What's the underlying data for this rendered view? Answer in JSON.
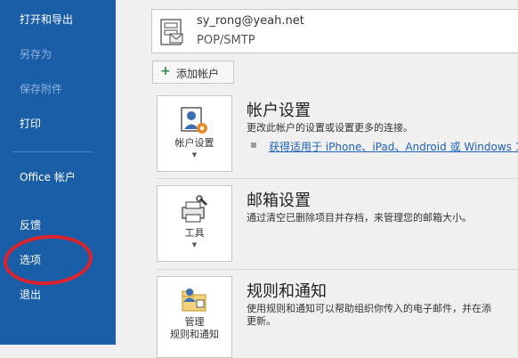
{
  "nav": {
    "items": [
      {
        "label": "打开和导出",
        "enabled": true
      },
      {
        "label": "另存为",
        "enabled": false
      },
      {
        "label": "保存附件",
        "enabled": false
      },
      {
        "label": "打印",
        "enabled": true
      },
      {
        "label": "Office 帐户",
        "enabled": true
      },
      {
        "label": "反馈",
        "enabled": true
      },
      {
        "label": "选项",
        "enabled": true
      },
      {
        "label": "退出",
        "enabled": true
      }
    ]
  },
  "account": {
    "email": "sy_rong@yeah.net",
    "type": "POP/SMTP",
    "icon": "mail-server-icon"
  },
  "add_account_label": "添加帐户",
  "sections": [
    {
      "tile_label": "帐户设置",
      "icon": "account-settings-icon",
      "title": "帐户设置",
      "description": "更改此帐户的设置或设置更多的连接。",
      "link": "获得适用于 iPhone、iPad、Android 或 Windows 1"
    },
    {
      "tile_label": "工具",
      "icon": "tools-icon",
      "title": "邮箱设置",
      "description": "通过清空已删除项目并存档，来管理您的邮箱大小。"
    },
    {
      "tile_label_line1": "管理",
      "tile_label_line2": "规则和通知",
      "icon": "rules-alerts-icon",
      "title": "规则和通知",
      "description_line1": "使用规则和通知可以帮助组织你传入的电子邮件，并在添",
      "description_line2": "更新。"
    }
  ],
  "colors": {
    "nav_background": "#1b5ea8",
    "annotation_ring": "#e0222c",
    "link": "#1f62b5"
  }
}
